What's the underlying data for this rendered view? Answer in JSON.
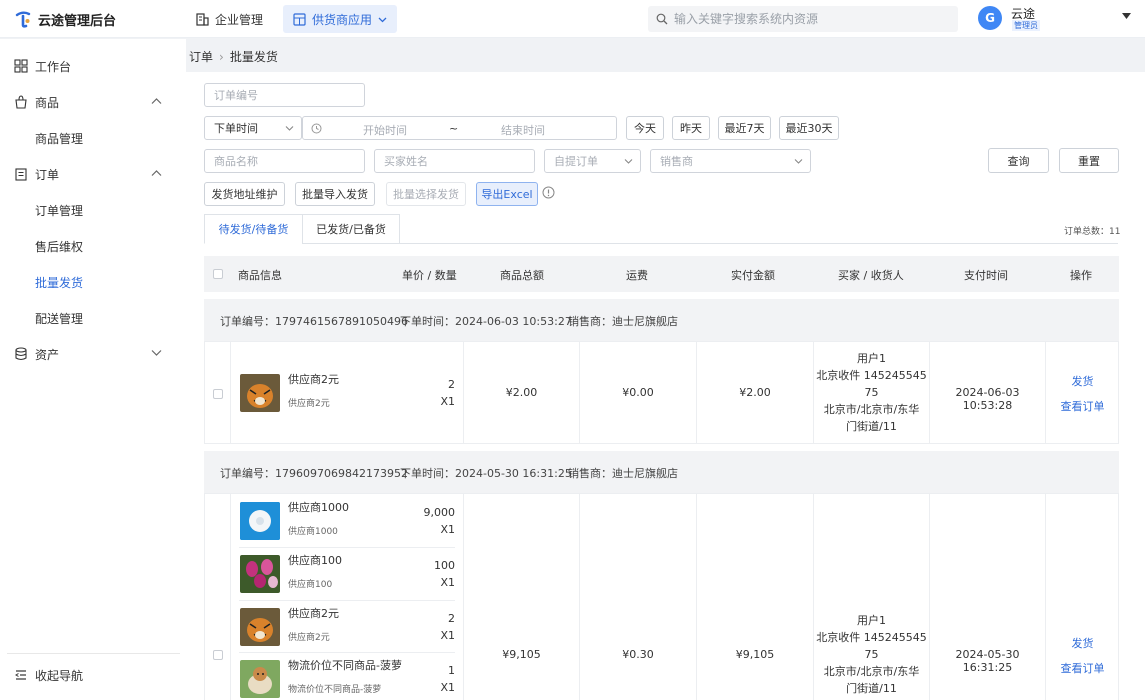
{
  "app": {
    "title": "云途管理后台"
  },
  "topnav": [
    {
      "label": "企业管理",
      "icon": "building-icon"
    },
    {
      "label": "供货商应用",
      "icon": "shop-icon"
    }
  ],
  "search": {
    "placeholder": "输入关键字搜索系统内资源"
  },
  "user": {
    "initial": "G",
    "name": "云途",
    "role": "管理员"
  },
  "sidebar": {
    "items": [
      {
        "label": "工作台"
      },
      {
        "label": "商品"
      },
      {
        "label": "商品管理"
      },
      {
        "label": "订单"
      },
      {
        "label": "订单管理"
      },
      {
        "label": "售后维权"
      },
      {
        "label": "批量发货"
      },
      {
        "label": "配送管理"
      },
      {
        "label": "资产"
      }
    ],
    "collapse_label": "收起导航"
  },
  "breadcrumb": {
    "parent": "订单",
    "current": "批量发货"
  },
  "filters": {
    "order_no_ph": "订单编号",
    "time_type": "下单时间",
    "start_ph": "开始时间",
    "range_sep": "~",
    "end_ph": "结束时间",
    "today": "今天",
    "yesterday": "昨天",
    "last7": "最近7天",
    "last30": "最近30天",
    "product_ph": "商品名称",
    "buyer_ph": "买家姓名",
    "pickup_ph": "自提订单",
    "seller_ph": "销售商",
    "query": "查询",
    "reset": "重置"
  },
  "actions": {
    "address": "发货地址维护",
    "import": "批量导入发货",
    "batch_select": "批量选择发货",
    "export": "导出Excel"
  },
  "tabs": [
    "待发货/待备货",
    "已发货/已备货"
  ],
  "order_count": "订单总数：11",
  "table": {
    "headers": [
      "商品信息",
      "单价 / 数量",
      "商品总额",
      "运费",
      "实付金额",
      "买家 / 收货人",
      "支付时间",
      "操作"
    ]
  },
  "orders": [
    {
      "no": "订单编号：1797461567891050496",
      "time": "下单时间：2024-06-03 10:53:27",
      "seller": "销售商：迪士尼旗舰店",
      "items": [
        {
          "name": "供应商2元",
          "sub": "供应商2元",
          "price": "2",
          "qty": "X1",
          "thumb": "tiger"
        }
      ],
      "total": "¥2.00",
      "freight": "¥0.00",
      "paid": "¥2.00",
      "buyer": [
        "用户1",
        "北京收件 145245545",
        "75",
        "北京市/北京市/东华",
        "门街道/11"
      ],
      "pay_time": "2024-06-03 10:53:28",
      "ship": "发货",
      "view": "查看订单"
    },
    {
      "no": "订单编号：1796097069842173952",
      "time": "下单时间：2024-05-30 16:31:25",
      "seller": "销售商：迪士尼旗舰店",
      "items": [
        {
          "name": "供应商1000",
          "sub": "供应商1000",
          "price": "9,000",
          "qty": "X1",
          "thumb": "dandelion"
        },
        {
          "name": "供应商100",
          "sub": "供应商100",
          "price": "100",
          "qty": "X1",
          "thumb": "tulip"
        },
        {
          "name": "供应商2元",
          "sub": "供应商2元",
          "price": "2",
          "qty": "X1",
          "thumb": "tiger"
        },
        {
          "name": "物流价位不同商品-菠萝",
          "sub": "物流价位不同商品-菠萝",
          "price": "1",
          "qty": "X1",
          "thumb": "dog"
        }
      ],
      "total": "¥9,105",
      "freight": "¥0.30",
      "paid": "¥9,105",
      "buyer": [
        "用户1",
        "北京收件 145245545",
        "75",
        "北京市/北京市/东华",
        "门街道/11"
      ],
      "pay_time": "2024-05-30 16:31:25",
      "ship": "发货",
      "view": "查看订单"
    }
  ]
}
